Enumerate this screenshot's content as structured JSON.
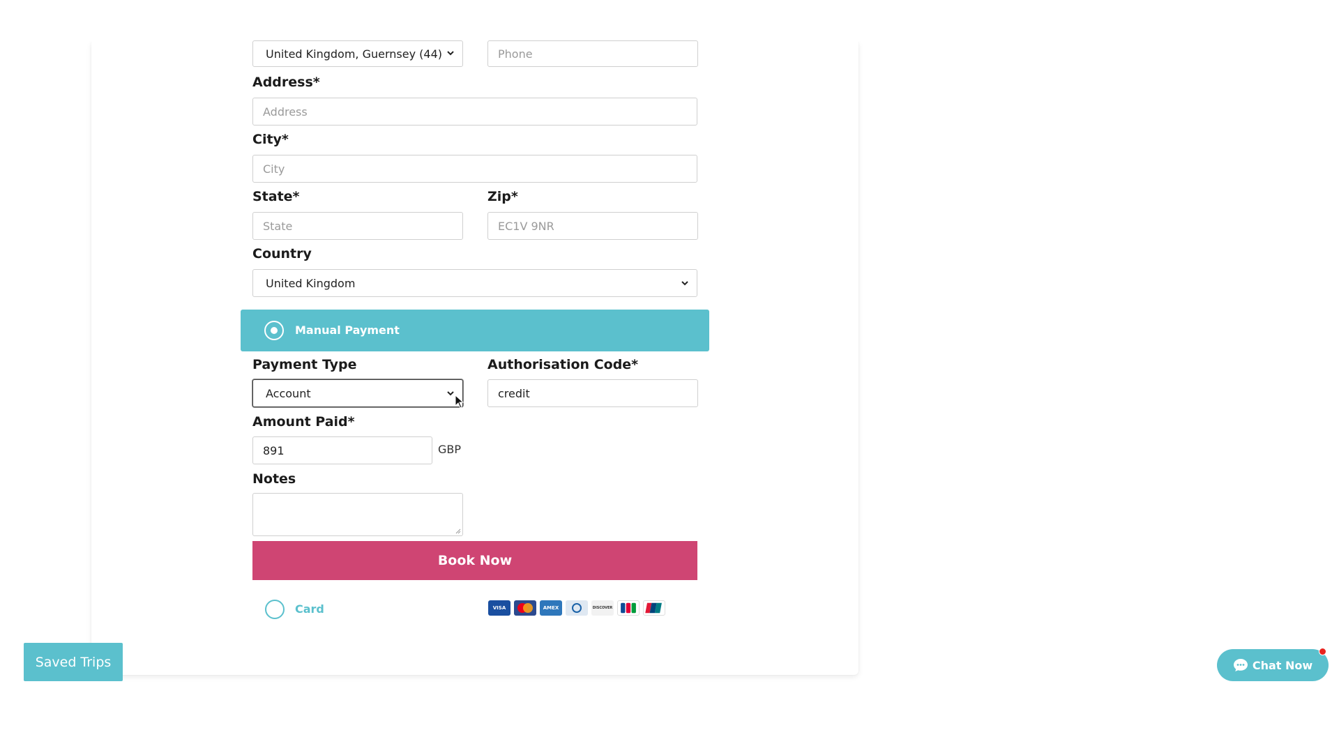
{
  "contact": {
    "phone_country_value": "United Kingdom, Guernsey (44)",
    "phone_placeholder": "Phone"
  },
  "address": {
    "label": "Address*",
    "placeholder": "Address"
  },
  "city": {
    "label": "City*",
    "placeholder": "City"
  },
  "state": {
    "label": "State*",
    "placeholder": "State"
  },
  "zip": {
    "label": "Zip*",
    "placeholder": "EC1V 9NR"
  },
  "country": {
    "label": "Country",
    "value": "United Kingdom"
  },
  "manual_payment": {
    "label": "Manual Payment",
    "selected": true
  },
  "payment_type": {
    "label": "Payment Type",
    "value": "Account"
  },
  "authorisation": {
    "label": "Authorisation Code*",
    "value": "credit"
  },
  "amount_paid": {
    "label": "Amount Paid*",
    "value": "891",
    "currency": "GBP"
  },
  "notes": {
    "label": "Notes",
    "value": ""
  },
  "book_now": {
    "label": "Book Now"
  },
  "card_payment": {
    "label": "Card",
    "selected": false,
    "brands": [
      "VISA",
      "mastercard",
      "AMEX",
      "diners",
      "DISCOVER",
      "JCB",
      "UnionPay"
    ]
  },
  "saved_trips": {
    "label": "Saved Trips"
  },
  "chat": {
    "label": "Chat Now",
    "has_notification": true
  },
  "colors": {
    "accent_teal": "#5bc0cd",
    "book_button": "#cf4573",
    "notification": "#e8231e"
  }
}
